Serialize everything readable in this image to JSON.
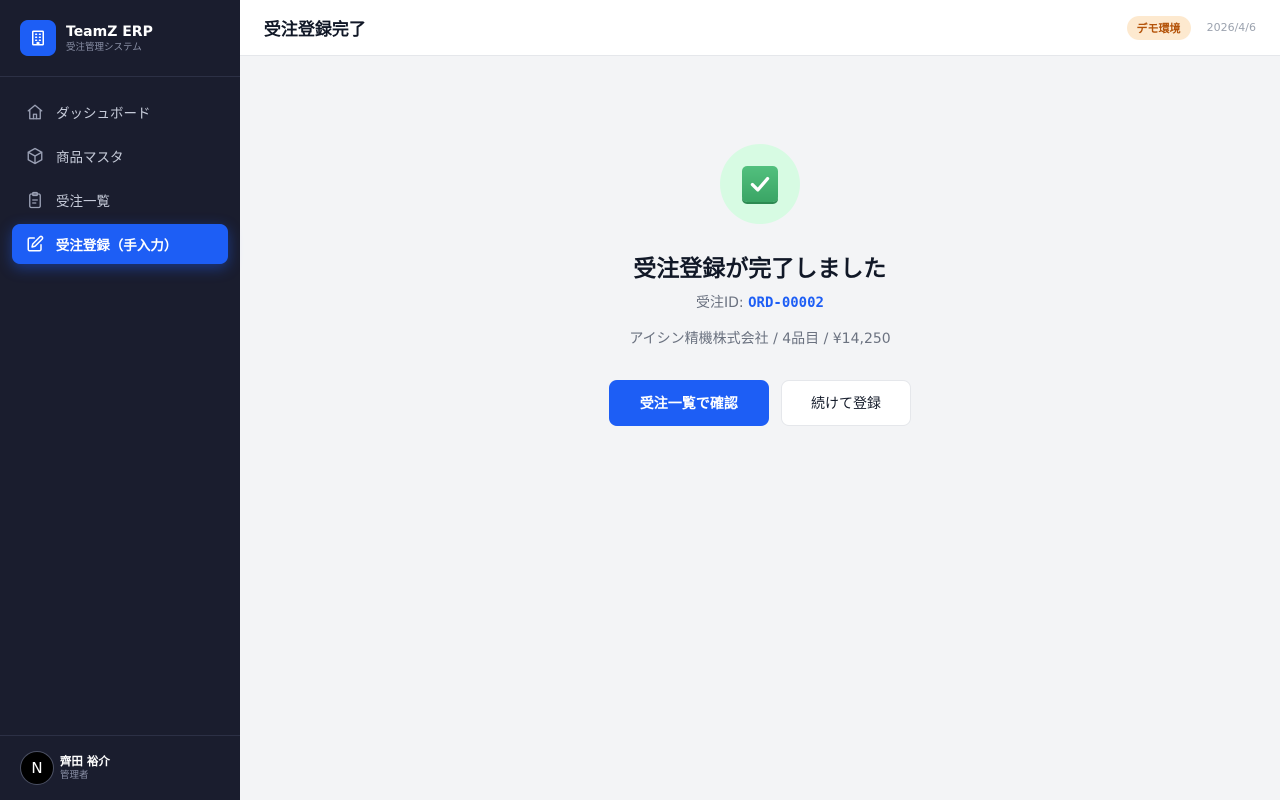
{
  "app": {
    "name": "TeamZ ERP",
    "subtitle": "受注管理システム"
  },
  "sidebar": {
    "items": [
      {
        "label": "ダッシュボード",
        "icon": "home-icon",
        "active": false
      },
      {
        "label": "商品マスタ",
        "icon": "box-icon",
        "active": false
      },
      {
        "label": "受注一覧",
        "icon": "clipboard-icon",
        "active": false
      },
      {
        "label": "受注登録（手入力）",
        "icon": "edit-icon",
        "active": true
      }
    ]
  },
  "user": {
    "avatar_initial": "N",
    "name": "齊田 裕介",
    "role": "管理者"
  },
  "header": {
    "title": "受注登録完了",
    "badge": "デモ環境",
    "date": "2026/4/6"
  },
  "main": {
    "title": "受注登録が完了しました",
    "order_id_label": "受注ID:",
    "order_id": "ORD-00002",
    "summary": "アイシン精機株式会社 / 4品目 / ¥14,250",
    "primary_button": "受注一覧で確認",
    "secondary_button": "続けて登録"
  },
  "colors": {
    "accent": "#1d5ef5",
    "sidebar_bg": "#1a1d2e",
    "success_bg": "#d7fbe3",
    "success": "#3aa565",
    "badge_bg": "#fde9cf",
    "badge_text": "#b45309"
  }
}
